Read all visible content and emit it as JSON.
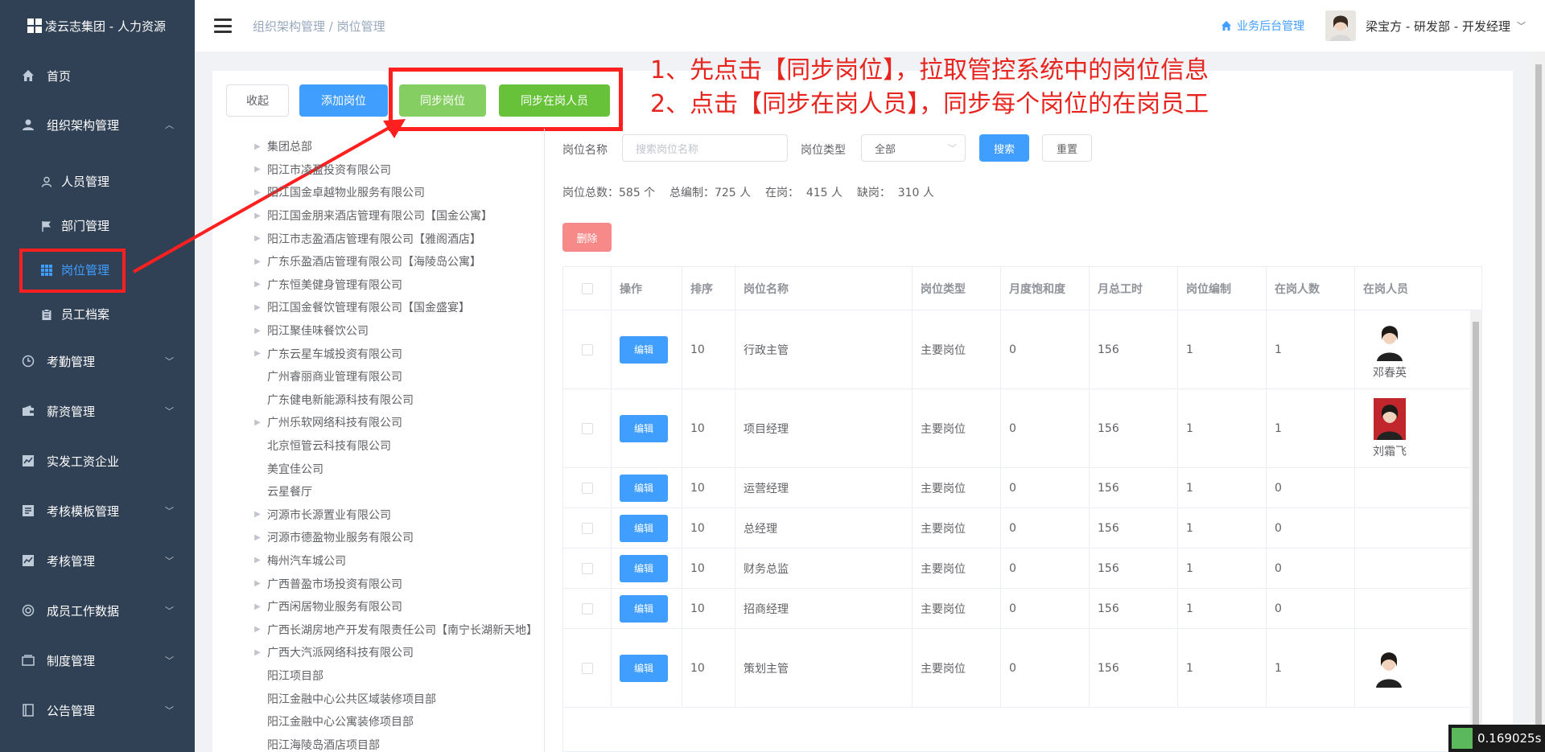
{
  "app": {
    "title": "凌云志集团 - 人力资源"
  },
  "sidebar": {
    "items": [
      {
        "label": "首页",
        "icon": "home-icon"
      },
      {
        "label": "组织架构管理",
        "icon": "user-icon",
        "expanded": true
      },
      {
        "label": "考勤管理",
        "icon": "clock-icon"
      },
      {
        "label": "薪资管理",
        "icon": "wallet-icon"
      },
      {
        "label": "实发工资企业",
        "icon": "chart-icon"
      },
      {
        "label": "考核模板管理",
        "icon": "template-icon"
      },
      {
        "label": "考核管理",
        "icon": "chart-icon"
      },
      {
        "label": "成员工作数据",
        "icon": "data-icon"
      },
      {
        "label": "制度管理",
        "icon": "folder-icon"
      },
      {
        "label": "公告管理",
        "icon": "notice-icon"
      }
    ],
    "sub_items": [
      {
        "label": "人员管理",
        "icon": "person-icon"
      },
      {
        "label": "部门管理",
        "icon": "flag-icon"
      },
      {
        "label": "岗位管理",
        "icon": "grid-icon",
        "active": true
      },
      {
        "label": "员工档案",
        "icon": "clipboard-icon"
      }
    ]
  },
  "header": {
    "breadcrumb": "组织架构管理 / 岗位管理",
    "biz_link": "业务后台管理",
    "user": "梁宝方 - 研发部 - 开发经理"
  },
  "toolbar": {
    "collapse": "收起",
    "add_post": "添加岗位",
    "sync_post": "同步岗位",
    "sync_staff": "同步在岗人员"
  },
  "annotation": {
    "line1": "1、先点击【同步岗位】，拉取管控系统中的岗位信息",
    "line2": "2、点击【同步在岗人员】，同步每个岗位的在岗员工"
  },
  "tree": [
    {
      "label": "集团总部",
      "arrow": true
    },
    {
      "label": "阳江市凌盈投资有限公司",
      "arrow": true
    },
    {
      "label": "阳江国金卓越物业服务有限公司",
      "arrow": true
    },
    {
      "label": "阳江国金朋来酒店管理有限公司【国金公寓】",
      "arrow": true
    },
    {
      "label": "阳江市志盈酒店管理有限公司【雅阁酒店】",
      "arrow": true
    },
    {
      "label": "广东乐盈酒店管理有限公司【海陵岛公寓】",
      "arrow": true
    },
    {
      "label": "广东恒美健身管理有限公司",
      "arrow": true
    },
    {
      "label": "阳江国金餐饮管理有限公司【国金盛宴】",
      "arrow": true
    },
    {
      "label": "阳江聚佳味餐饮公司",
      "arrow": true
    },
    {
      "label": "广东云星车城投资有限公司",
      "arrow": true
    },
    {
      "label": "广州睿丽商业管理有限公司",
      "arrow": false
    },
    {
      "label": "广东健电新能源科技有限公司",
      "arrow": false
    },
    {
      "label": "广州乐软网络科技有限公司",
      "arrow": true
    },
    {
      "label": "北京恒管云科技有限公司",
      "arrow": false
    },
    {
      "label": "美宜佳公司",
      "arrow": false
    },
    {
      "label": "云星餐厅",
      "arrow": false
    },
    {
      "label": "河源市长源置业有限公司",
      "arrow": true
    },
    {
      "label": "河源市德盈物业服务有限公司",
      "arrow": true
    },
    {
      "label": "梅州汽车城公司",
      "arrow": true
    },
    {
      "label": "广西普盈市场投资有限公司",
      "arrow": true
    },
    {
      "label": "广西闲居物业服务有限公司",
      "arrow": true
    },
    {
      "label": "广西长湖房地产开发有限责任公司【南宁长湖新天地】",
      "arrow": true
    },
    {
      "label": "广西大汽派网络科技有限公司",
      "arrow": true
    },
    {
      "label": "阳江项目部",
      "arrow": false
    },
    {
      "label": "阳江金融中心公共区域装修项目部",
      "arrow": false
    },
    {
      "label": "阳江金融中心公寓装修项目部",
      "arrow": false
    },
    {
      "label": "阳江海陵岛酒店项目部",
      "arrow": false
    }
  ],
  "filters": {
    "name_label": "岗位名称",
    "name_placeholder": "搜索岗位名称",
    "type_label": "岗位类型",
    "type_value": "全部",
    "search": "搜索",
    "reset": "重置"
  },
  "stats": "岗位总数：585 个    总编制：725 人    在岗：  415 人    缺岗：  310 人",
  "delete_label": "删除",
  "table": {
    "headers": [
      "操作",
      "排序",
      "岗位名称",
      "岗位类型",
      "月度饱和度",
      "月总工时",
      "岗位编制",
      "在岗人数",
      "在岗人员"
    ],
    "edit_label": "编辑",
    "rows": [
      {
        "sort": "10",
        "name": "行政主管",
        "type": "主要岗位",
        "saturation": "0",
        "hours": "156",
        "quota": "1",
        "count": "1",
        "person": "邓春英"
      },
      {
        "sort": "10",
        "name": "项目经理",
        "type": "主要岗位",
        "saturation": "0",
        "hours": "156",
        "quota": "1",
        "count": "1",
        "person": "刘霜飞"
      },
      {
        "sort": "10",
        "name": "运营经理",
        "type": "主要岗位",
        "saturation": "0",
        "hours": "156",
        "quota": "1",
        "count": "0",
        "person": ""
      },
      {
        "sort": "10",
        "name": "总经理",
        "type": "主要岗位",
        "saturation": "0",
        "hours": "156",
        "quota": "1",
        "count": "0",
        "person": ""
      },
      {
        "sort": "10",
        "name": "财务总监",
        "type": "主要岗位",
        "saturation": "0",
        "hours": "156",
        "quota": "1",
        "count": "0",
        "person": ""
      },
      {
        "sort": "10",
        "name": "招商经理",
        "type": "主要岗位",
        "saturation": "0",
        "hours": "156",
        "quota": "1",
        "count": "0",
        "person": ""
      },
      {
        "sort": "10",
        "name": "策划主管",
        "type": "主要岗位",
        "saturation": "0",
        "hours": "156",
        "quota": "1",
        "count": "1",
        "person": ""
      }
    ]
  },
  "timer": "0.169025s"
}
